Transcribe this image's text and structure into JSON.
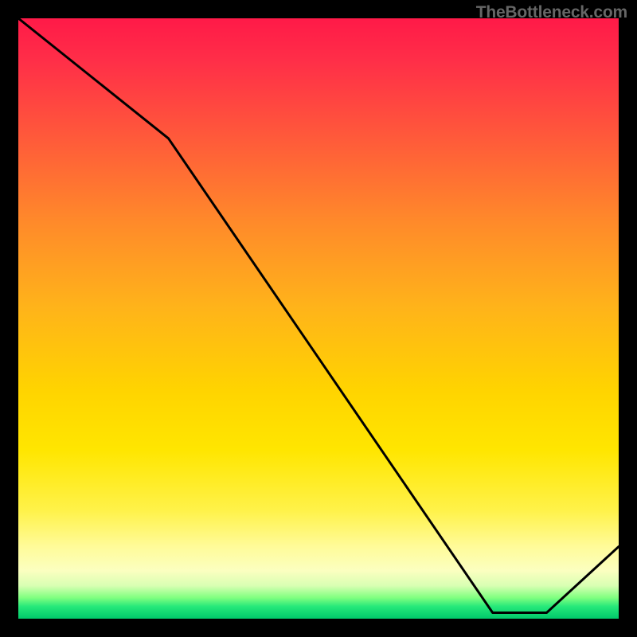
{
  "watermark": "TheBottleneck.com",
  "floor_label": "",
  "colors": {
    "top": "#ff1a48",
    "mid": "#ffd400",
    "bottom": "#00c96b",
    "curve": "#000000",
    "border": "#000000"
  },
  "chart_data": {
    "type": "line",
    "title": "",
    "xlabel": "",
    "ylabel": "",
    "xlim": [
      0,
      100
    ],
    "ylim": [
      0,
      100
    ],
    "series": [
      {
        "name": "curve",
        "x": [
          0,
          25,
          79,
          88,
          100
        ],
        "values": [
          100,
          80,
          1,
          1,
          12
        ]
      }
    ],
    "annotations": [
      {
        "text": "TheBottleneck.com",
        "pos": "top-right"
      }
    ]
  }
}
